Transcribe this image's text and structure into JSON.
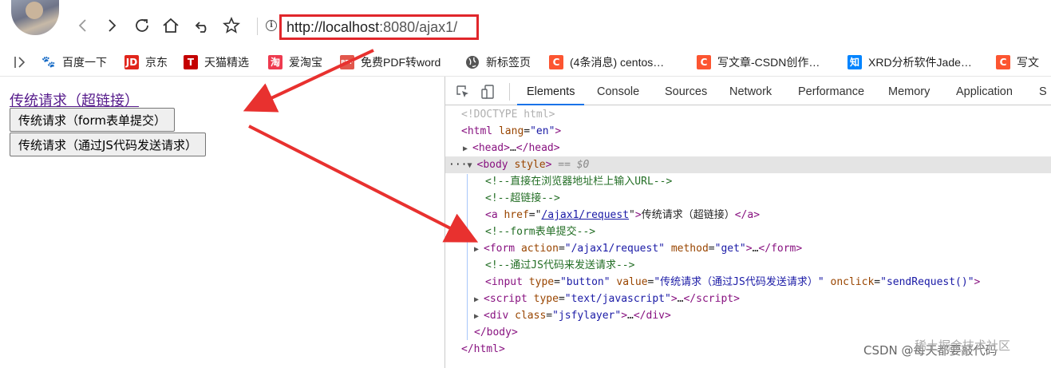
{
  "browser": {
    "url_host": "http://localhost",
    "url_rest": ":8080/ajax1/",
    "icons": [
      "avatar",
      "back-icon",
      "forward-icon",
      "reload-icon",
      "home-icon",
      "undo-icon",
      "star-icon",
      "info-icon"
    ]
  },
  "bookmarks": [
    {
      "label": "百度一下",
      "icon": "baidu-icon",
      "glyph": "🐾",
      "color": "#2932e1"
    },
    {
      "label": "京东",
      "icon": "jd-icon",
      "glyph": "JD",
      "color": "#e1251b"
    },
    {
      "label": "天猫精选",
      "icon": "tmall-icon",
      "glyph": "T",
      "color": "#c40000"
    },
    {
      "label": "爱淘宝",
      "icon": "taobao-icon",
      "glyph": "淘",
      "color": "#ee3a4f"
    },
    {
      "label": "免费PDF转word",
      "icon": "pdf-icon",
      "glyph": "PDF",
      "color": "#e2574c"
    },
    {
      "label": "新标签页",
      "icon": "globe-icon",
      "glyph": "",
      "color": "#555555"
    },
    {
      "label": "(4条消息) centos…",
      "icon": "csdn-icon",
      "glyph": "C",
      "color": "#fc5531"
    },
    {
      "label": "写文章-CSDN创作…",
      "icon": "csdn-icon",
      "glyph": "C",
      "color": "#fc5531"
    },
    {
      "label": "XRD分析软件Jade…",
      "icon": "zhihu-icon",
      "glyph": "知",
      "color": "#0084ff"
    },
    {
      "label": "写文",
      "icon": "csdn-icon",
      "glyph": "C",
      "color": "#fc5531"
    }
  ],
  "page": {
    "link_text": "传统请求（超链接）",
    "form_button": "传统请求（form表单提交）",
    "js_button": "传统请求（通过JS代码发送请求）"
  },
  "devtools": {
    "tabs": [
      "Elements",
      "Console",
      "Sources",
      "Network",
      "Performance",
      "Memory",
      "Application",
      "S"
    ],
    "active_tab": "Elements",
    "lines": {
      "doctype": "<!DOCTYPE html>",
      "html_tag": "html",
      "lang_attr": "lang",
      "lang_val": "\"en\"",
      "head": "head",
      "head_ellipsis": "…",
      "body_dots": "···",
      "body_tag": "body",
      "body_attr": "style",
      "body_eq": "== $0",
      "c1": "<!--直接在浏览器地址栏上输入URL-->",
      "c2": "<!--超链接-->",
      "a_tag": "a",
      "a_attr": "href",
      "a_val": "/ajax1/request",
      "a_text": "传统请求（超链接）",
      "c3": "<!--form表单提交-->",
      "form_tag": "form",
      "form_attr1": "action",
      "form_val1": "\"/ajax1/request\"",
      "form_attr2": "method",
      "form_val2": "\"get\"",
      "c4": "<!--通过JS代码来发送请求-->",
      "input_tag": "input",
      "input_attr1": "type",
      "input_val1": "\"button\"",
      "input_attr2": "value",
      "input_val2": "\"传统请求（通过JS代码发送请求）\"",
      "input_attr3": "onclick",
      "input_val3": "\"sendRequest()\"",
      "script_tag": "script",
      "script_attr": "type",
      "script_val": "\"text/javascript\"",
      "div_tag": "div",
      "div_attr": "class",
      "div_val": "\"jsfylayer\"",
      "body_close": "</body>",
      "html_close": "</html>"
    }
  },
  "watermark": {
    "text": "CSDN @每天都要敲代码",
    "ghost": "稀土掘金技术社区"
  }
}
